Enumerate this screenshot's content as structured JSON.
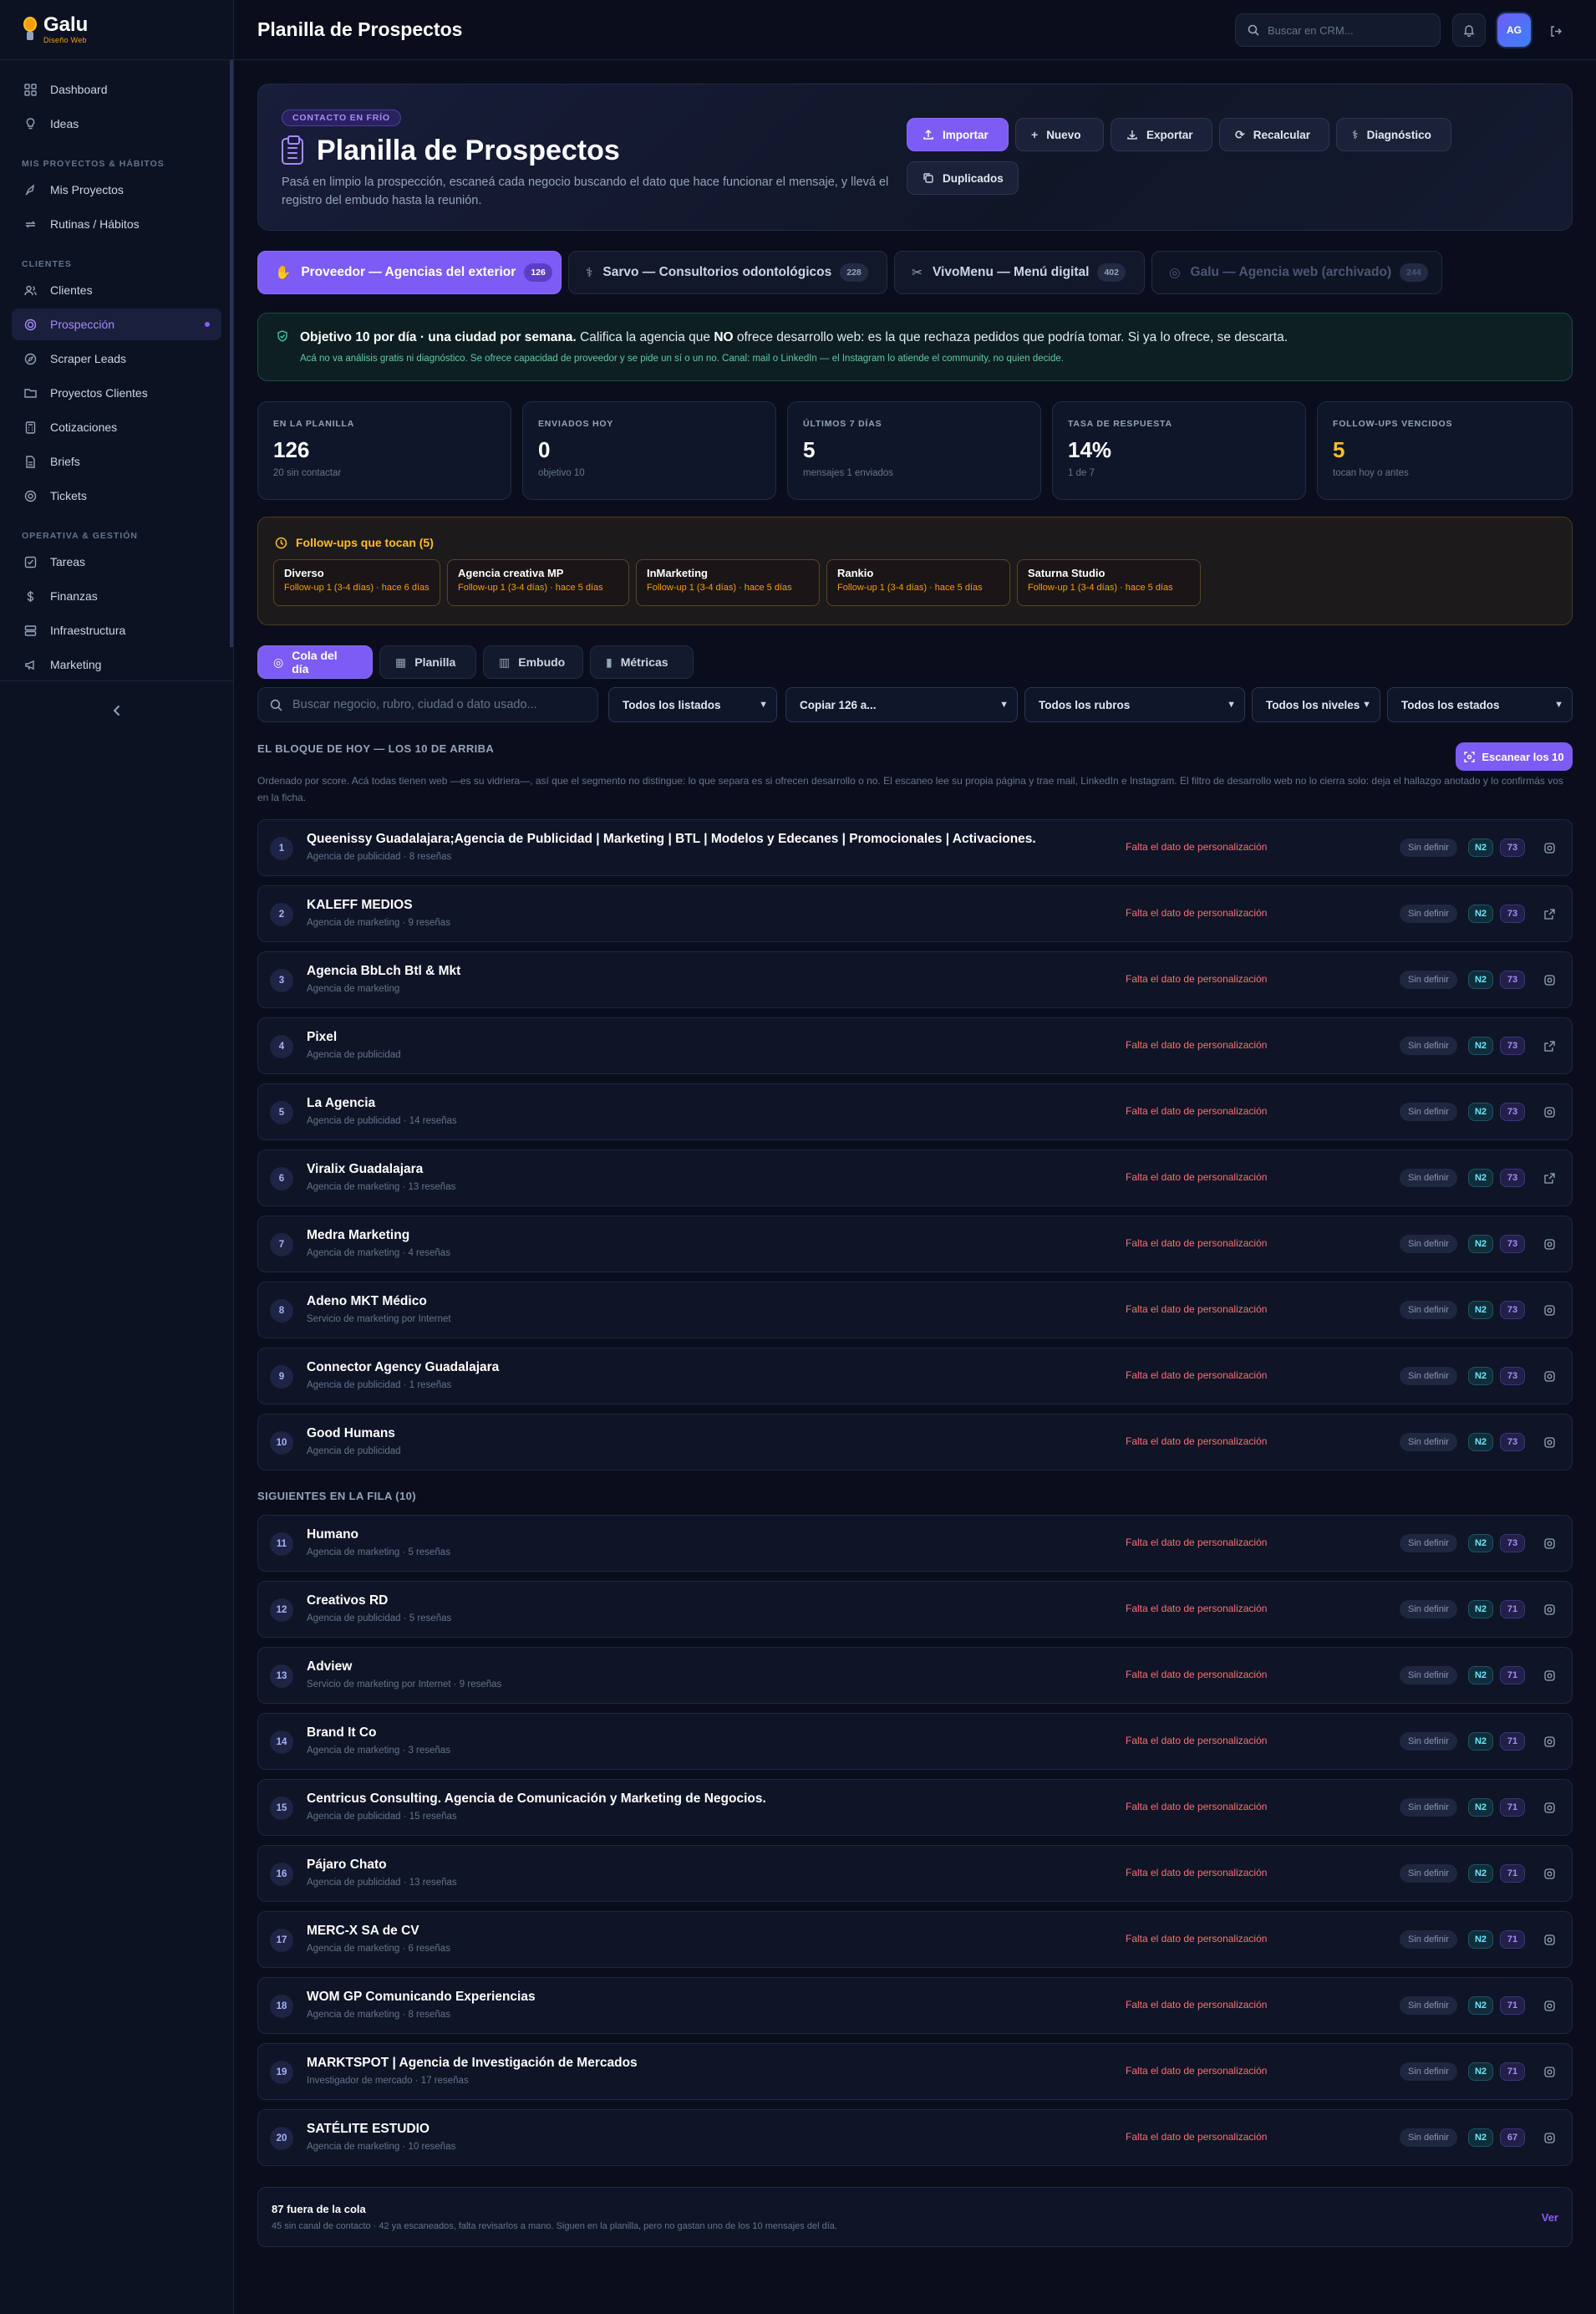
{
  "app": {
    "name": "Galu",
    "tagline": "Diseño Web"
  },
  "sidebar": {
    "items_top": [
      {
        "label": "Dashboard",
        "icon": "grid-icon"
      },
      {
        "label": "Ideas",
        "icon": "lightbulb-icon"
      }
    ],
    "section1": "MIS PROYECTOS & HÁBITOS",
    "items_s1": [
      {
        "label": "Mis Proyectos",
        "icon": "rocket-icon"
      },
      {
        "label": "Rutinas / Hábitos",
        "icon": "repeat-icon"
      }
    ],
    "section2": "CLIENTES",
    "items_s2": [
      {
        "label": "Clientes",
        "icon": "users-icon"
      },
      {
        "label": "Prospección",
        "icon": "target-icon",
        "active": true
      },
      {
        "label": "Scraper Leads",
        "icon": "compass-icon"
      },
      {
        "label": "Proyectos Clientes",
        "icon": "folder-icon"
      },
      {
        "label": "Cotizaciones",
        "icon": "calculator-icon"
      },
      {
        "label": "Briefs",
        "icon": "file-icon"
      },
      {
        "label": "Tickets",
        "icon": "lifebuoy-icon"
      }
    ],
    "section3": "OPERATIVA & GESTIÓN",
    "items_s3": [
      {
        "label": "Tareas",
        "icon": "check-square-icon"
      },
      {
        "label": "Finanzas",
        "icon": "dollar-icon"
      },
      {
        "label": "Infraestructura",
        "icon": "server-icon"
      },
      {
        "label": "Marketing",
        "icon": "megaphone-icon"
      }
    ]
  },
  "topbar": {
    "title": "Planilla de Prospectos",
    "search_placeholder": "Buscar en CRM...",
    "avatar_initials": "AG"
  },
  "hero": {
    "badge": "CONTACTO EN FRÍO",
    "title": "Planilla de Prospectos",
    "description": "Pasá en limpio la prospección, escaneá cada negocio buscando el dato que hace funcionar el mensaje, y llevá el registro del embudo hasta la reunión.",
    "buttons": {
      "import": "Importar",
      "new": "Nuevo",
      "export": "Exportar",
      "recalc": "Recalcular",
      "diagnostic": "Diagnóstico",
      "duplicates": "Duplicados"
    }
  },
  "pipelines": [
    {
      "label": "Proveedor — Agencias del exterior",
      "count": "126"
    },
    {
      "label": "Sarvo — Consultorios odontológicos",
      "count": "228"
    },
    {
      "label": "VivoMenu — Menú digital",
      "count": "402"
    },
    {
      "label": "Galu — Agencia web (archivado)",
      "count": "244"
    }
  ],
  "objective": {
    "lead": "Objetivo 10 por día · una ciudad por semana.",
    "text_a": " Califica la agencia que ",
    "text_no": "NO",
    "text_b": " ofrece desarrollo web: es la que rechaza pedidos que podría tomar. Si ya lo ofrece, se descarta.",
    "note": "Acá no va análisis gratis ni diagnóstico. Se ofrece capacidad de proveedor y se pide un sí o un no. Canal: mail o LinkedIn — el Instagram lo atiende el community, no quien decide."
  },
  "stats": [
    {
      "label": "EN LA PLANILLA",
      "value": "126",
      "sub": "20 sin contactar"
    },
    {
      "label": "ENVIADOS HOY",
      "value": "0",
      "sub": "objetivo 10"
    },
    {
      "label": "ÚLTIMOS 7 DÍAS",
      "value": "5",
      "sub": "mensajes 1 enviados"
    },
    {
      "label": "TASA DE RESPUESTA",
      "value": "14%",
      "sub": "1 de 7"
    },
    {
      "label": "FOLLOW-UPS VENCIDOS",
      "value": "5",
      "sub": "tocan hoy o antes"
    }
  ],
  "followups": {
    "title": "Follow-ups que tocan (5)",
    "items": [
      {
        "name": "Diverso",
        "detail": "Follow-up 1 (3-4 días) · hace 6 días"
      },
      {
        "name": "Agencia creativa MP",
        "detail": "Follow-up 1 (3-4 días) · hace 5 días"
      },
      {
        "name": "InMarketing",
        "detail": "Follow-up 1 (3-4 días) · hace 5 días"
      },
      {
        "name": "Rankio",
        "detail": "Follow-up 1 (3-4 días) · hace 5 días"
      },
      {
        "name": "Saturna Studio",
        "detail": "Follow-up 1 (3-4 días) · hace 5 días"
      }
    ]
  },
  "views": [
    {
      "label": "Cola del día"
    },
    {
      "label": "Planilla"
    },
    {
      "label": "Embudo"
    },
    {
      "label": "Métricas"
    }
  ],
  "filters": {
    "search_placeholder": "Buscar negocio, rubro, ciudad o dato usado...",
    "listados": "Todos los listados",
    "copy": "Copiar 126 a...",
    "rubros": "Todos los rubros",
    "niveles": "Todos los niveles",
    "estados": "Todos los estados"
  },
  "block": {
    "title": "EL BLOQUE DE HOY — LOS 10 DE ARRIBA",
    "scan_button": "Escanear los 10",
    "description": "Ordenado por score. Acá todas tienen web —es su vidriera—, así que el segmento no distingue: lo que separa es si ofrecen desarrollo o no. El escaneo lee su propia página y trae mail, LinkedIn e Instagram. El filtro de desarrollo web no lo cierra solo: deja el hallazgo anotado y lo confirmás vos en la ficha."
  },
  "row_labels": {
    "missing": "Falta el dato de personalización",
    "undefined": "Sin definir"
  },
  "top10": [
    {
      "n": "1",
      "name": "Queenissy Guadalajara;Agencia de Publicidad | Marketing | BTL | Modelos y Edecanes | Promocionales | Activaciones.",
      "cat": "Agencia de publicidad · 8 reseñas",
      "level": "N2",
      "score": "73",
      "action": "scan-icon"
    },
    {
      "n": "2",
      "name": "KALEFF MEDIOS",
      "cat": "Agencia de marketing · 9 reseñas",
      "level": "N2",
      "score": "73",
      "action": "external-link-icon"
    },
    {
      "n": "3",
      "name": "Agencia BbLch Btl & Mkt",
      "cat": "Agencia de marketing",
      "level": "N2",
      "score": "73",
      "action": "scan-icon"
    },
    {
      "n": "4",
      "name": "Pixel",
      "cat": "Agencia de publicidad",
      "level": "N2",
      "score": "73",
      "action": "external-link-icon"
    },
    {
      "n": "5",
      "name": "La Agencia",
      "cat": "Agencia de publicidad · 14 reseñas",
      "level": "N2",
      "score": "73",
      "action": "scan-icon"
    },
    {
      "n": "6",
      "name": "Viralix Guadalajara",
      "cat": "Agencia de marketing · 13 reseñas",
      "level": "N2",
      "score": "73",
      "action": "external-link-icon"
    },
    {
      "n": "7",
      "name": "Medra Marketing",
      "cat": "Agencia de marketing · 4 reseñas",
      "level": "N2",
      "score": "73",
      "action": "scan-icon"
    },
    {
      "n": "8",
      "name": "Adeno MKT Médico",
      "cat": "Servicio de marketing por Internet",
      "level": "N2",
      "score": "73",
      "action": "scan-icon"
    },
    {
      "n": "9",
      "name": "Connector Agency Guadalajara",
      "cat": "Agencia de publicidad · 1 reseñas",
      "level": "N2",
      "score": "73",
      "action": "scan-icon"
    },
    {
      "n": "10",
      "name": "Good Humans",
      "cat": "Agencia de publicidad",
      "level": "N2",
      "score": "73",
      "action": "scan-icon"
    }
  ],
  "next": {
    "title": "SIGUIENTES EN LA FILA (10)",
    "rows": [
      {
        "n": "11",
        "name": "Humano",
        "cat": "Agencia de marketing · 5 reseñas",
        "level": "N2",
        "score": "73",
        "action": "scan-icon"
      },
      {
        "n": "12",
        "name": "Creativos RD",
        "cat": "Agencia de publicidad · 5 reseñas",
        "level": "N2",
        "score": "71",
        "action": "scan-icon"
      },
      {
        "n": "13",
        "name": "Adview",
        "cat": "Servicio de marketing por Internet · 9 reseñas",
        "level": "N2",
        "score": "71",
        "action": "scan-icon"
      },
      {
        "n": "14",
        "name": "Brand It Co",
        "cat": "Agencia de marketing · 3 reseñas",
        "level": "N2",
        "score": "71",
        "action": "scan-icon"
      },
      {
        "n": "15",
        "name": "Centricus Consulting. Agencia de Comunicación y Marketing de Negocios.",
        "cat": "Agencia de publicidad · 15 reseñas",
        "level": "N2",
        "score": "71",
        "action": "scan-icon"
      },
      {
        "n": "16",
        "name": "Pájaro Chato",
        "cat": "Agencia de publicidad · 13 reseñas",
        "level": "N2",
        "score": "71",
        "action": "scan-icon"
      },
      {
        "n": "17",
        "name": "MERC-X SA de CV",
        "cat": "Agencia de marketing · 6 reseñas",
        "level": "N2",
        "score": "71",
        "action": "scan-icon"
      },
      {
        "n": "18",
        "name": "WOM GP Comunicando Experiencias",
        "cat": "Agencia de marketing · 8 reseñas",
        "level": "N2",
        "score": "71",
        "action": "scan-icon"
      },
      {
        "n": "19",
        "name": "MARKTSPOT | Agencia de Investigación de Mercados",
        "cat": "Investigador de mercado · 17 reseñas",
        "level": "N2",
        "score": "71",
        "action": "scan-icon"
      },
      {
        "n": "20",
        "name": "SATÉLITE ESTUDIO",
        "cat": "Agencia de marketing · 10 reseñas",
        "level": "N2",
        "score": "67",
        "action": "scan-icon"
      }
    ]
  },
  "outside": {
    "title": "87 fuera de la cola",
    "detail": "45 sin canal de contacto · 42 ya escaneados, falta revisarlos a mano. Siguen en la planilla, pero no gastan uno de los 10 mensajes del día.",
    "link": "Ver"
  }
}
